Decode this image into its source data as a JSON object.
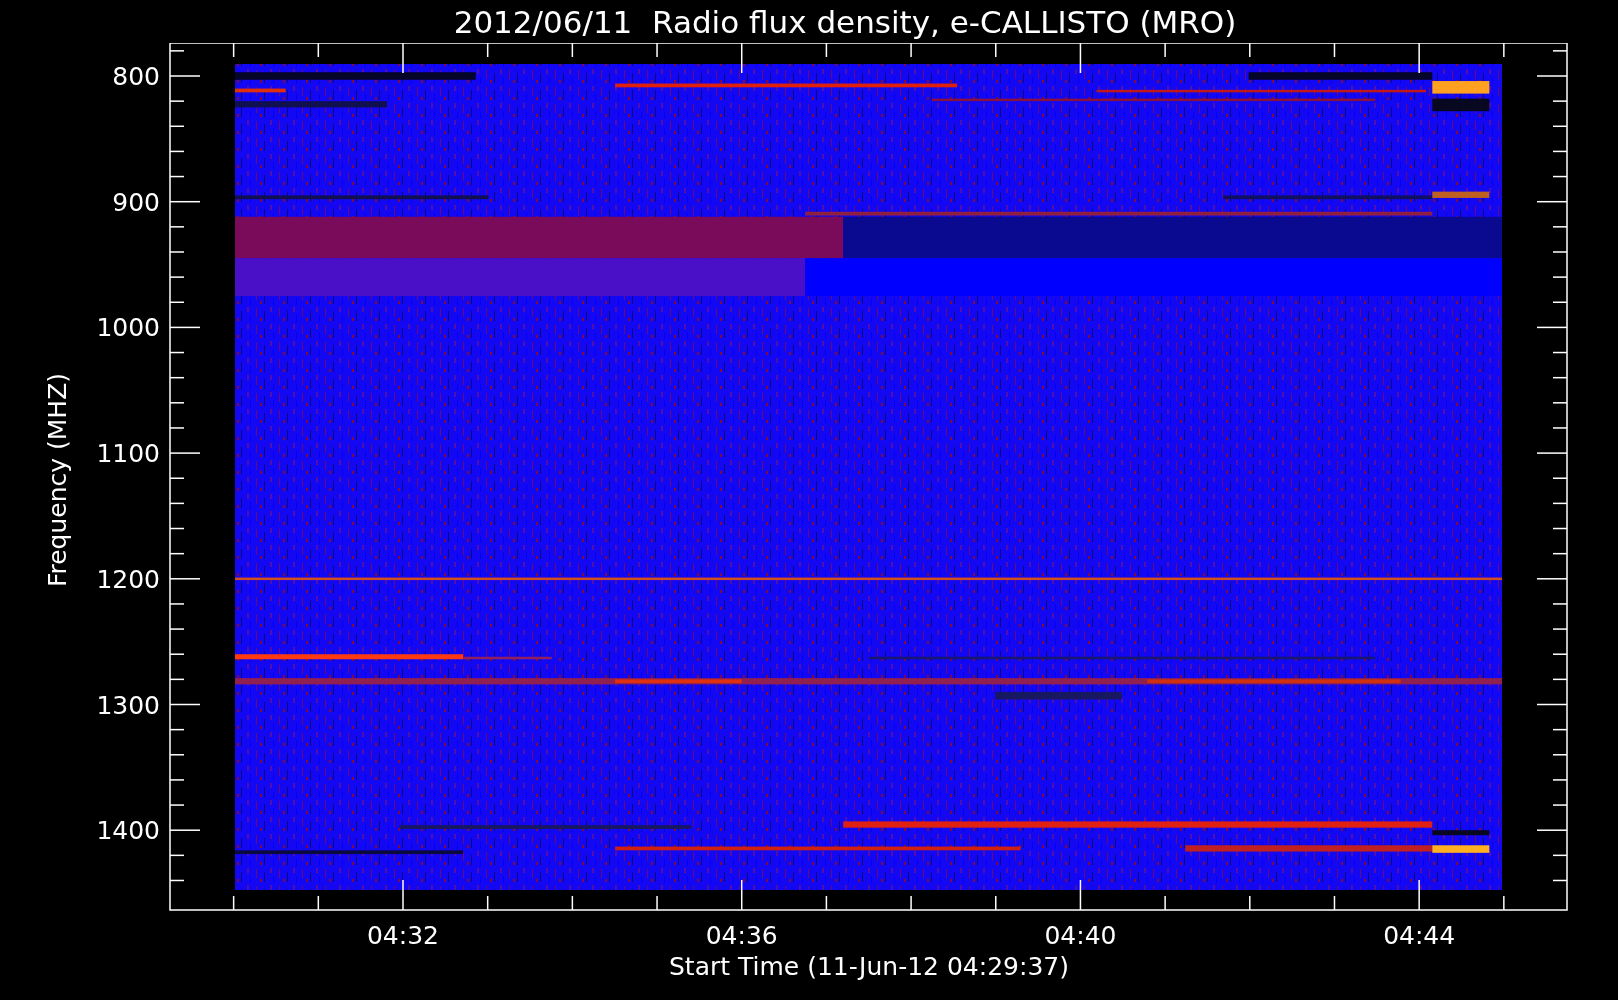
{
  "title": "2012/06/11  Radio flux density, e-CALLISTO (MRO)",
  "plot": {
    "y_axis": {
      "label": "Frequency (MHZ)",
      "ticks": [
        "800",
        "900",
        "1000",
        "1100",
        "1200",
        "1300",
        "1400"
      ]
    },
    "x_axis": {
      "label": "Start Time (11-Jun-12 04:29:37)",
      "ticks": [
        "04:32",
        "04:36",
        "04:40",
        "04:44"
      ]
    }
  }
}
